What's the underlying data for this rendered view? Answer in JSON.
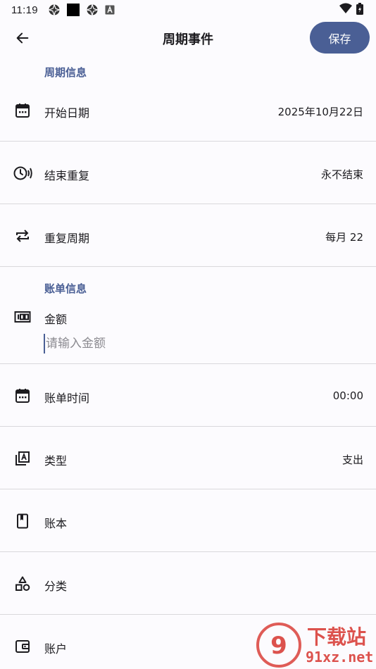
{
  "status_bar": {
    "time": "11:19",
    "icons": [
      "aperture-icon",
      "black-square-icon",
      "aperture-icon",
      "a-icon",
      "wifi-icon",
      "battery-icon"
    ]
  },
  "header": {
    "title": "周期事件",
    "save_label": "保存",
    "back_icon": "arrow-left-icon"
  },
  "cycle_section": {
    "label": "周期信息",
    "rows": [
      {
        "label": "开始日期",
        "value": "2025年10月22日",
        "icon": "calendar-icon"
      },
      {
        "label": "结束重复",
        "value": "永不结束",
        "icon": "clock-signal-icon"
      },
      {
        "label": "重复周期",
        "value": "每月 22",
        "icon": "repeat-icon"
      }
    ]
  },
  "bill_section": {
    "label": "账单信息",
    "amount": {
      "label": "金额",
      "placeholder": "请输入金额",
      "value": "",
      "icon": "counter-icon"
    },
    "rows": [
      {
        "label": "账单时间",
        "value": "00:00",
        "icon": "calendar-icon"
      },
      {
        "label": "类型",
        "value": "支出",
        "icon": "type-library-icon"
      },
      {
        "label": "账本",
        "value": "",
        "icon": "book-icon"
      },
      {
        "label": "分类",
        "value": "",
        "icon": "shapes-icon"
      },
      {
        "label": "账户",
        "value": "",
        "icon": "wallet-icon"
      }
    ]
  },
  "watermark": {
    "brand": "下载站",
    "domain": "91xz.net"
  },
  "colors": {
    "accent": "#4a5f95",
    "background": "#fcfbfe",
    "divider": "#d9d8dc",
    "text": "#1c1b1f",
    "watermark": "#d9403a"
  }
}
